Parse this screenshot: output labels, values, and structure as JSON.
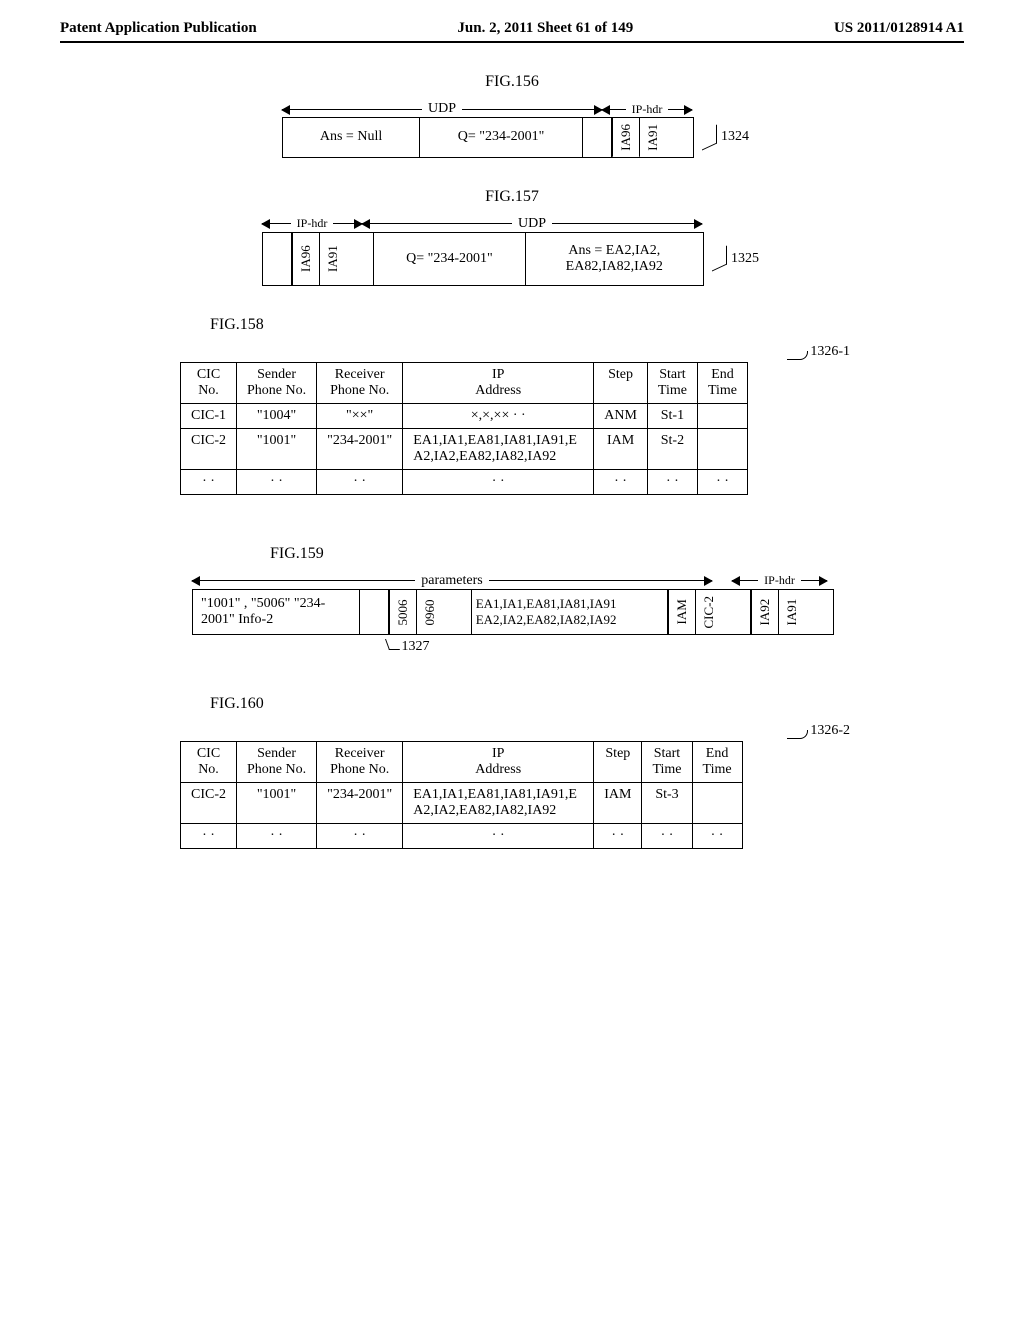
{
  "header": {
    "left": "Patent Application Publication",
    "center": "Jun. 2, 2011  Sheet 61 of 149",
    "right": "US 2011/0128914 A1"
  },
  "fig156": {
    "title": "FIG.156",
    "span1": "UDP",
    "span2": "IP-hdr",
    "ans": "Ans = Null",
    "q": "Q=  \"234-2001\"",
    "addr1": "IA96",
    "addr2": "IA91",
    "ref": "1324"
  },
  "fig157": {
    "title": "FIG.157",
    "span1": "IP-hdr",
    "span2": "UDP",
    "addr1": "IA96",
    "addr2": "IA91",
    "q": "Q=  \"234-2001\"",
    "ans": "Ans = EA2,IA2, EA82,IA82,IA92",
    "ref": "1325"
  },
  "fig158": {
    "title": "FIG.158",
    "ref": "1326-1",
    "headers": [
      "CIC No.",
      "Sender Phone No.",
      "Receiver Phone No.",
      "IP Address",
      "Step",
      "Start Time",
      "End Time"
    ],
    "rows": [
      [
        "CIC-1",
        "\"1004\"",
        "\"××\"",
        "×,×,×× · ·",
        "ANM",
        "St-1",
        ""
      ],
      [
        "CIC-2",
        "\"1001\"",
        "\"234-2001\"",
        "EA1,IA1,EA81,IA81,IA91,EA2,IA2,EA82,IA82,IA92",
        "IAM",
        "St-2",
        ""
      ],
      [
        "· ·",
        "· ·",
        "· ·",
        "· ·",
        "· ·",
        "· ·",
        "· ·"
      ]
    ]
  },
  "fig159": {
    "title": "FIG.159",
    "span1": "parameters",
    "span2": "IP-hdr",
    "cell1": "\"1001\" ,  \"5006\" \"234-2001\"  Info-2",
    "port1": "5006",
    "port2": "0960",
    "addrs": "EA1,IA1,EA81,IA81,IA91 EA2,IA2,EA82,IA82,IA92",
    "iam": "IAM",
    "cic": "CIC-2",
    "addr1": "IA92",
    "addr2": "IA91",
    "ref": "1327"
  },
  "fig160": {
    "title": "FIG.160",
    "ref": "1326-2",
    "headers": [
      "CIC No.",
      "Sender Phone No.",
      "Receiver Phone No.",
      "IP Address",
      "Step",
      "Start Time",
      "End Time"
    ],
    "rows": [
      [
        "CIC-2",
        "\"1001\"",
        "\"234-2001\"",
        "EA1,IA1,EA81,IA81,IA91,EA2,IA2,EA82,IA82,IA92",
        "IAM",
        "St-3",
        ""
      ],
      [
        "· ·",
        "· ·",
        "· ·",
        "· ·",
        "· ·",
        "· ·",
        "· ·"
      ]
    ]
  }
}
